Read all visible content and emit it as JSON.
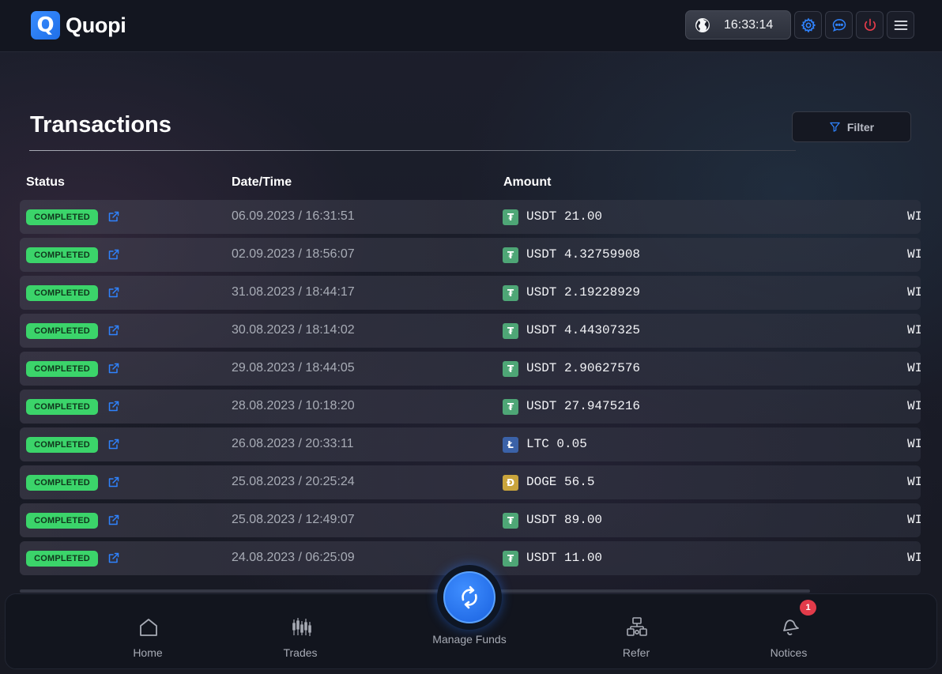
{
  "header": {
    "brand": "Quopi",
    "logo_letter": "Q",
    "time": "16:33:14"
  },
  "page": {
    "title": "Transactions",
    "filter_label": "Filter"
  },
  "table": {
    "columns": [
      "Status",
      "Date/Time",
      "Amount"
    ],
    "rows": [
      {
        "status": "COMPLETED",
        "datetime": "06.09.2023 / 16:31:51",
        "coin": "USDT",
        "coin_glyph": "₮",
        "coin_color": "#4ea676",
        "amount": "USDT 21.00",
        "type": "WI"
      },
      {
        "status": "COMPLETED",
        "datetime": "02.09.2023 / 18:56:07",
        "coin": "USDT",
        "coin_glyph": "₮",
        "coin_color": "#4ea676",
        "amount": "USDT 4.32759908",
        "type": "WI"
      },
      {
        "status": "COMPLETED",
        "datetime": "31.08.2023 / 18:44:17",
        "coin": "USDT",
        "coin_glyph": "₮",
        "coin_color": "#4ea676",
        "amount": "USDT 2.19228929",
        "type": "WI"
      },
      {
        "status": "COMPLETED",
        "datetime": "30.08.2023 / 18:14:02",
        "coin": "USDT",
        "coin_glyph": "₮",
        "coin_color": "#4ea676",
        "amount": "USDT 4.44307325",
        "type": "WI"
      },
      {
        "status": "COMPLETED",
        "datetime": "29.08.2023 / 18:44:05",
        "coin": "USDT",
        "coin_glyph": "₮",
        "coin_color": "#4ea676",
        "amount": "USDT 2.90627576",
        "type": "WI"
      },
      {
        "status": "COMPLETED",
        "datetime": "28.08.2023 / 10:18:20",
        "coin": "USDT",
        "coin_glyph": "₮",
        "coin_color": "#4ea676",
        "amount": "USDT 27.9475216",
        "type": "WI"
      },
      {
        "status": "COMPLETED",
        "datetime": "26.08.2023 / 20:33:11",
        "coin": "LTC",
        "coin_glyph": "Ł",
        "coin_color": "#3b62a8",
        "amount": "LTC 0.05",
        "type": "WI"
      },
      {
        "status": "COMPLETED",
        "datetime": "25.08.2023 / 20:25:24",
        "coin": "DOGE",
        "coin_glyph": "Ð",
        "coin_color": "#c9a43c",
        "amount": "DOGE 56.5",
        "type": "WI"
      },
      {
        "status": "COMPLETED",
        "datetime": "25.08.2023 / 12:49:07",
        "coin": "USDT",
        "coin_glyph": "₮",
        "coin_color": "#4ea676",
        "amount": "USDT 89.00",
        "type": "WI"
      },
      {
        "status": "COMPLETED",
        "datetime": "24.08.2023 / 06:25:09",
        "coin": "USDT",
        "coin_glyph": "₮",
        "coin_color": "#4ea676",
        "amount": "USDT 11.00",
        "type": "WI"
      }
    ]
  },
  "nav": {
    "items": [
      {
        "label": "Home",
        "icon": "home-icon"
      },
      {
        "label": "Trades",
        "icon": "candlestick-icon"
      },
      {
        "label": "Manage Funds",
        "icon": "exchange-icon"
      },
      {
        "label": "Refer",
        "icon": "refer-icon"
      },
      {
        "label": "Notices",
        "icon": "bell-icon"
      }
    ],
    "notices_count": "1"
  },
  "colors": {
    "accent": "#2b7bff",
    "completed": "#3bd46a",
    "danger": "#e23b4a"
  }
}
